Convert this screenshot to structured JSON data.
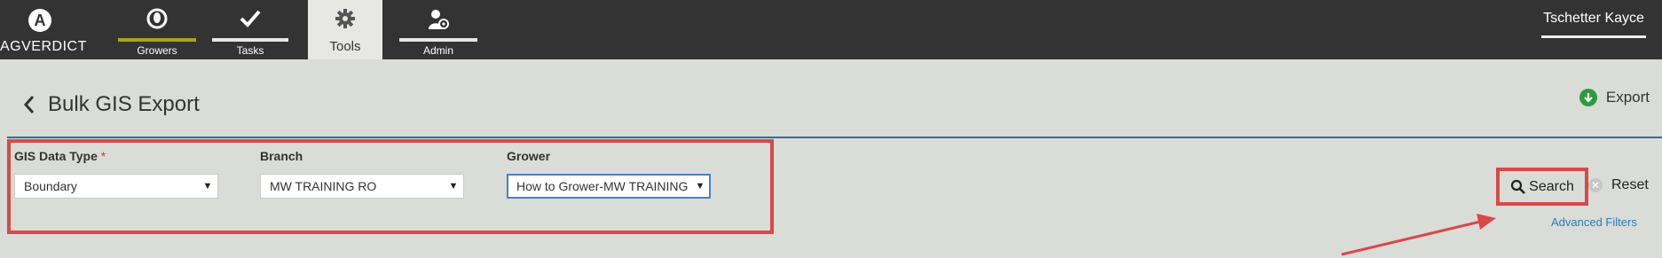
{
  "nav": {
    "logo_text": "AGVERDICT",
    "items": [
      {
        "label": "Growers",
        "icon": "grower-icon"
      },
      {
        "label": "Tasks",
        "icon": "check-icon"
      },
      {
        "label": "Tools",
        "icon": "gear-icon"
      },
      {
        "label": "Admin",
        "icon": "admin-user-gear-icon"
      }
    ],
    "user_name": "Tschetter Kayce"
  },
  "page": {
    "title": "Bulk GIS Export",
    "export_label": "Export"
  },
  "filters": {
    "gis_data_type": {
      "label": "GIS Data Type",
      "required_mark": "*",
      "value": "Boundary"
    },
    "branch": {
      "label": "Branch",
      "value": "MW TRAINING RO"
    },
    "grower": {
      "label": "Grower",
      "value": "How to Grower-MW TRAINING"
    }
  },
  "actions": {
    "search_label": "Search",
    "reset_label": "Reset",
    "advanced_filters_label": "Advanced Filters"
  },
  "colors": {
    "topbar": "#333333",
    "accent_blue": "#2a6f97",
    "annotation_red": "#d9484a",
    "growers_bar": "#a8a41c",
    "export_green": "#2e9a3e"
  }
}
